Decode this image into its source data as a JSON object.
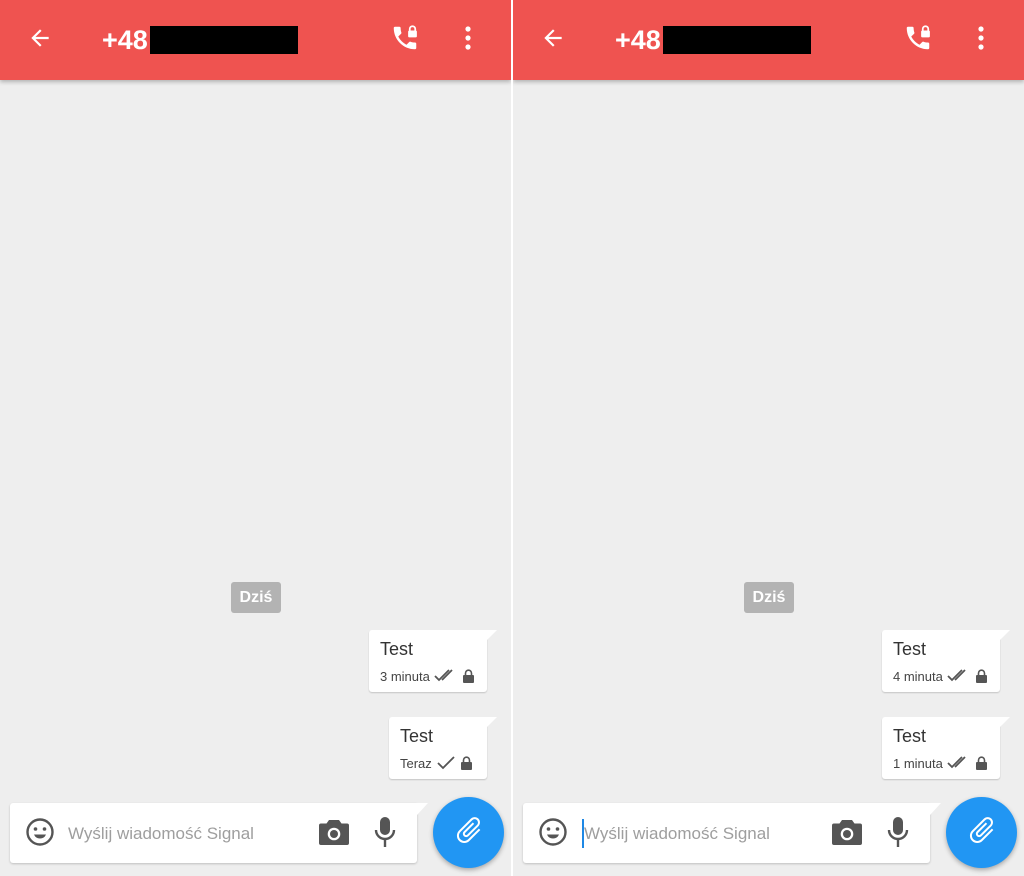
{
  "accent_color": "#ef5350",
  "fab_color": "#2196f3",
  "panels": [
    {
      "toolbar": {
        "back_icon": "arrow-back-icon",
        "contact_prefix": "+48",
        "call_icon": "secure-call-icon",
        "menu_icon": "more-vert-icon"
      },
      "date_divider": "Dziś",
      "messages": [
        {
          "text": "Test",
          "time": "3 minuta",
          "status_icon": "double-check-icon",
          "lock_icon": "lock-icon"
        },
        {
          "text": "Test",
          "time": "Teraz",
          "status_icon": "check-icon",
          "lock_icon": "lock-icon"
        }
      ],
      "composer": {
        "placeholder": "Wyślij wiadomość Signal",
        "emoji_icon": "emoji-icon",
        "camera_icon": "camera-icon",
        "mic_icon": "microphone-icon",
        "attach_icon": "paperclip-icon"
      }
    },
    {
      "toolbar": {
        "back_icon": "arrow-back-icon",
        "contact_prefix": "+48",
        "call_icon": "secure-call-icon",
        "menu_icon": "more-vert-icon"
      },
      "date_divider": "Dziś",
      "messages": [
        {
          "text": "Test",
          "time": "4 minuta",
          "status_icon": "double-check-icon",
          "lock_icon": "lock-icon"
        },
        {
          "text": "Test",
          "time": "1 minuta",
          "status_icon": "double-check-icon",
          "lock_icon": "lock-icon"
        }
      ],
      "composer": {
        "placeholder": "Wyślij wiadomość Signal",
        "emoji_icon": "emoji-icon",
        "camera_icon": "camera-icon",
        "mic_icon": "microphone-icon",
        "attach_icon": "paperclip-icon"
      }
    }
  ]
}
